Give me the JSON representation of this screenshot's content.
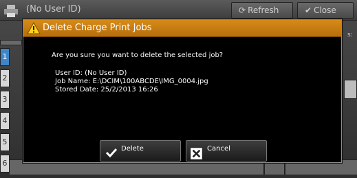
{
  "background": {
    "header_title": "(No User ID)",
    "refresh_label": "Refresh",
    "close_label": "Close",
    "row_numbers": [
      "1",
      "2",
      "3",
      "4",
      "5",
      "6"
    ],
    "right_label": "s:"
  },
  "dialog": {
    "title": "Delete Charge Print Jobs",
    "message": "Are you sure you want to delete the selected job?",
    "user_id": "User ID: (No User ID)",
    "job_name": "Job Name: E:\\DCIM\\100ABCDE\\IMG_0004.jpg",
    "stored_date": "Stored Date: 25/2/2013 16:26",
    "delete_label": "Delete",
    "cancel_label": "Cancel"
  },
  "colors": {
    "titlebar": "#c87c12",
    "dialog_bg": "#000000",
    "selected_row": "#3f86c9"
  },
  "icons": {
    "header": "printer-icon",
    "title": "warning-icon",
    "delete": "check-icon",
    "cancel": "x-icon"
  }
}
